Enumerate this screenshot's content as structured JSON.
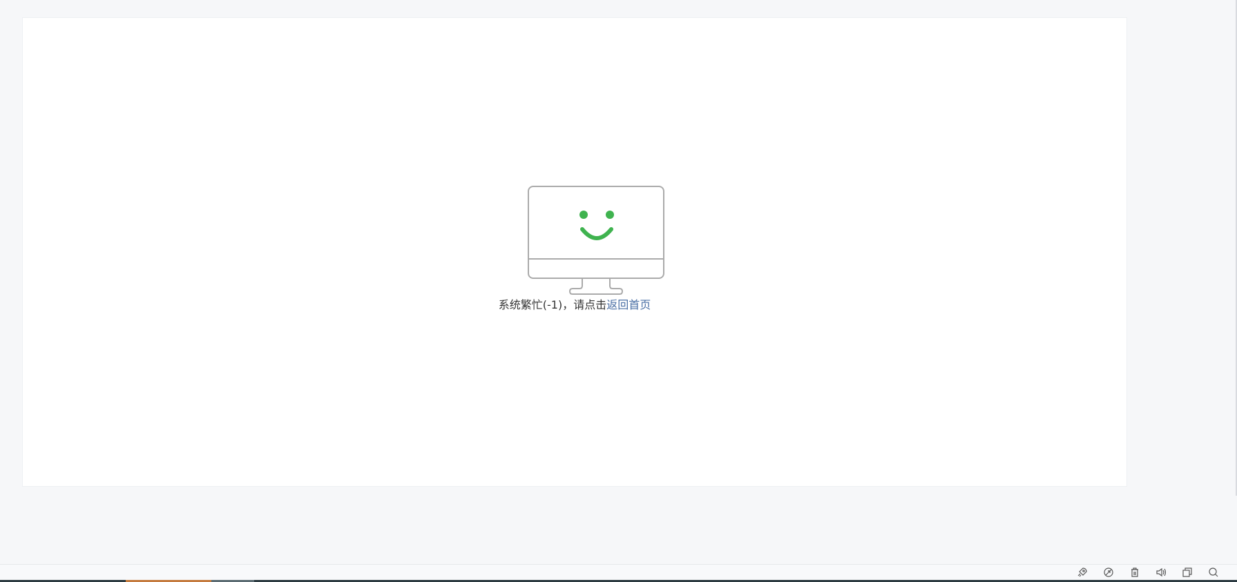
{
  "error": {
    "message_prefix": "系统繁忙(-1)，请点击",
    "link_text": "返回首页"
  },
  "colors": {
    "page_background": "#f6f7f9",
    "card_background": "#ffffff",
    "smile_color": "#3fb34f",
    "link_color": "#4a6fa5",
    "monitor_outline": "#aaaaaa"
  },
  "icons": {
    "illustration": "monitor-smile-icon",
    "tray": [
      "rocket-icon",
      "leaf-icon",
      "trash-icon",
      "speaker-icon",
      "window-icon",
      "search-icon"
    ]
  }
}
